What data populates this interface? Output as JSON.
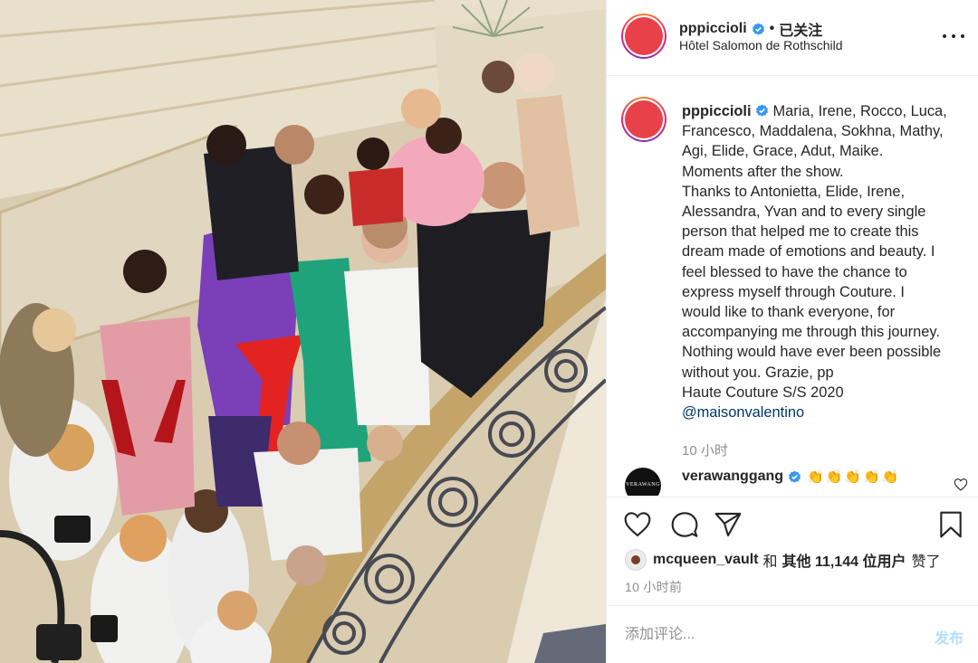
{
  "post": {
    "author": "pppiccioli",
    "follow_state": "已关注",
    "separator": "•",
    "location": "Hôtel Salomon de Rothschild",
    "avatar_color": "#e8414a",
    "verified_color": "#3897f0"
  },
  "caption": {
    "author": "pppiccioli",
    "lines": [
      "Maria, Irene, Rocco, Luca,",
      "Francesco, Maddalena, Sokhna, Mathy,",
      "Agi, Elide, Grace, Adut, Maike.",
      "Moments after the show.",
      "Thanks to Antonietta, Elide, Irene,",
      "Alessandra, Yvan and to every single",
      "person that helped me to create this",
      "dream made of emotions and beauty. I",
      "feel blessed to have the chance to",
      "express myself through Couture. I",
      "would like to thank everyone, for",
      "accompanying me through this journey.",
      "Nothing would have ever been possible",
      "without you. Grazie, pp",
      "Haute Couture S/S 2020"
    ],
    "mention": "@maisonvalentino",
    "time": "10 小时"
  },
  "comment2": {
    "author": "verawanggang",
    "avatar_text": "VERAWANG",
    "emojis": "👏👏👏👏👏"
  },
  "actions": {
    "like_icon": "heart-icon",
    "comment_icon": "comment-icon",
    "share_icon": "share-icon",
    "save_icon": "bookmark-icon"
  },
  "likes": {
    "user": "mcqueen_vault",
    "connector": "和",
    "others": "其他 11,144 位用户",
    "suffix": "赞了"
  },
  "post_time": "10 小时前",
  "comment_box": {
    "placeholder": "添加评论...",
    "post_label": "发布"
  }
}
